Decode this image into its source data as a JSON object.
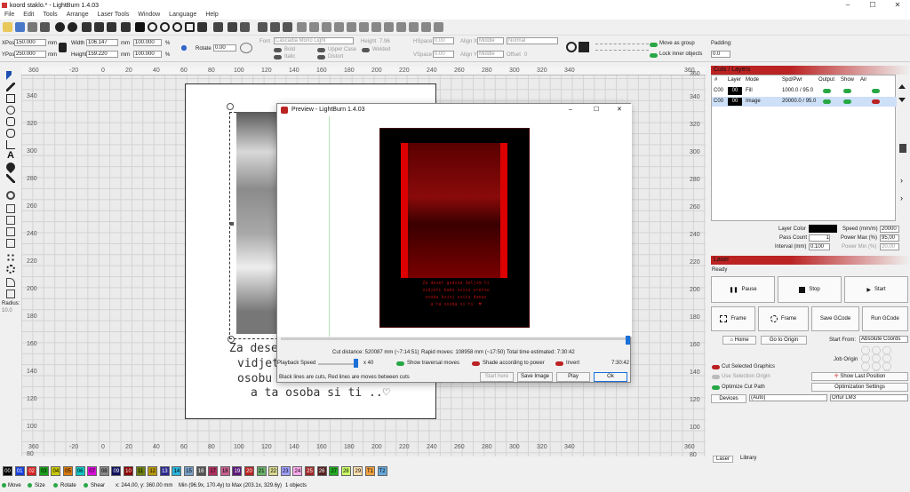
{
  "window": {
    "title": "koord staklo.* - LightBurn 1.4.03"
  },
  "menu": [
    "File",
    "Edit",
    "Tools",
    "Arrange",
    "Laser Tools",
    "Window",
    "Language",
    "Help"
  ],
  "position": {
    "xpos_label": "XPos",
    "xpos": "150.000",
    "ypos_label": "YPos",
    "ypos": "250.000",
    "unit": "mm",
    "width_label": "Width",
    "width": "106.147",
    "height_label": "Height",
    "height": "159.220",
    "wpct": "100.000",
    "hpct": "100.000",
    "pct": "%",
    "rotate_label": "Rotate",
    "rotate": "0.00"
  },
  "font": {
    "font_label": "Font",
    "font": "Cascadia Mono Light",
    "height_label": "Height",
    "height": "7.96",
    "hspace_label": "HSpace",
    "hspace": "0.00",
    "vspace_label": "VSpace",
    "vspace": "0.00",
    "bold": "Bold",
    "italic": "Italic",
    "upper": "Upper Case",
    "distort": "Distort",
    "welded": "Welded",
    "alignx_label": "Align X",
    "alignx": "Middle",
    "aligny_label": "Align Y",
    "aligny": "Middle",
    "normal": "Normal",
    "offset_label": "Offset",
    "offset": "0"
  },
  "group": {
    "move_as_group": "Move as group",
    "lock_inner": "Lock inner objects",
    "padding_label": "Padding:",
    "padding": "0.0"
  },
  "radius": {
    "label": "Radius:",
    "value": "10.0"
  },
  "ruler_top": [
    "-20",
    "0",
    "20",
    "40",
    "60",
    "80",
    "100",
    "120",
    "140",
    "160",
    "180",
    "200",
    "220",
    "240",
    "260",
    "280",
    "300",
    "320",
    "340",
    "360"
  ],
  "ruler_top_first": "360",
  "ruler_left": [
    "340",
    "320",
    "300",
    "280",
    "260",
    "240",
    "220",
    "200",
    "180",
    "160",
    "140",
    "120",
    "100",
    "80"
  ],
  "ruler_right": [
    "360",
    "340",
    "320",
    "300",
    "280",
    "260",
    "240",
    "220",
    "200",
    "180",
    "160",
    "140",
    "120",
    "100",
    "80"
  ],
  "ruler_bottom": [
    "360",
    "-20",
    "0",
    "20",
    "40",
    "60",
    "80",
    "100",
    "120",
    "140",
    "160",
    "180",
    "200",
    "220",
    "240",
    "260",
    "280",
    "300",
    "320",
    "340",
    "360"
  ],
  "poem": {
    "line1": "Za dese",
    "line2": "vidjet",
    "line3": "osobu",
    "line4": "a ta osoba si ti ..♡"
  },
  "preview": {
    "title": "Preview - LightBurn 1.4.03",
    "img_text": "Za deset godina željim ti\nvidjeti kako sviću sretnu\nosobu kojoj sviću danas\na ta osoba si ti  ♥",
    "cut_distance": "Cut distance: 520087 mm (~7:14:51)",
    "rapid": "Rapid moves: 108958 mm (~17:50)",
    "total": "Total time estimated: 7:30:42",
    "playback_label": "Playback Speed",
    "playback": "x 40",
    "show_traversal": "Show traversal moves",
    "shade": "Shade according to power",
    "invert": "Invert",
    "time": "7:30:42",
    "legend": "Black lines are cuts, Red lines are moves between cuts",
    "start_here": "Start here",
    "save_image": "Save Image",
    "play": "Play",
    "ok": "Ok"
  },
  "cuts": {
    "title": "Cuts / Layers",
    "cols": [
      "#",
      "Layer",
      "Mode",
      "Spd/Pwr",
      "Output",
      "Show",
      "Air"
    ],
    "rows": [
      {
        "num": "C00",
        "layer": "00",
        "mode": "Fill",
        "spd": "1000.0 / 95.0"
      },
      {
        "num": "C00",
        "layer": "00",
        "mode": "Image",
        "spd": "20000.0 / 95.0"
      }
    ],
    "layer_color_label": "Layer Color",
    "speed_label": "Speed (mm/m)",
    "speed": "20000",
    "pass_label": "Pass Count",
    "pass": "1",
    "pmax_label": "Power Max (%)",
    "pmax": "95,00",
    "interval_label": "Interval (mm)",
    "interval": "0.100",
    "pmin_label": "Power Min (%)",
    "pmin": "20,00"
  },
  "laser": {
    "title": "Laser",
    "status": "Ready",
    "pause": "Pause",
    "stop": "Stop",
    "start": "Start",
    "frame1": "Frame",
    "frame2": "Frame",
    "save_gcode": "Save GCode",
    "run_gcode": "Run GCode",
    "home": "Home",
    "goto_origin": "Go to Origin",
    "start_from_label": "Start From:",
    "start_from": "Absolute Coords",
    "job_origin": "Job Origin",
    "cut_selected": "Cut Selected Graphics",
    "use_selection": "Use Selection Origin",
    "show_last": "Show Last Position",
    "optimize": "Optimize Cut Path",
    "opt_settings": "Optimization Settings",
    "devices": "Devices",
    "auto": "(Auto)",
    "device": "Ortur LM3"
  },
  "tabs": {
    "laser": "Laser",
    "library": "Library"
  },
  "palette": [
    "00",
    "01",
    "02",
    "03",
    "04",
    "05",
    "06",
    "07",
    "08",
    "09",
    "10",
    "11",
    "12",
    "13",
    "14",
    "15",
    "16",
    "17",
    "18",
    "19",
    "20",
    "21",
    "22",
    "23",
    "24",
    "25",
    "26",
    "27",
    "28",
    "29",
    "T1",
    "T2"
  ],
  "palette_colors": [
    "#000",
    "#1740d8",
    "#d82020",
    "#1a9e1a",
    "#c8c800",
    "#d87a10",
    "#10c8c8",
    "#d810d8",
    "#888",
    "#11115c",
    "#8b0000",
    "#6b7f10",
    "#b8980c",
    "#2a2a8f",
    "#2ab3d8",
    "#78a0c8",
    "#555",
    "#b03060",
    "#c86090",
    "#5a1a7a",
    "#b82222",
    "#6ab06a",
    "#d8d890",
    "#a0a0ff",
    "#ffaaee",
    "#a02a2a",
    "#552222",
    "#22aa22",
    "#ccff66",
    "#ffe0b0",
    "#f0a040",
    "#66aadd"
  ],
  "status": {
    "move": "Move",
    "size": "Size",
    "rotate": "Rotate",
    "shear": "Shear",
    "coords": "x: 244.00, y: 360.00 mm",
    "minmax": "Min (96.9x, 170.4y) to Max (203.1x, 329.6y)",
    "objects": "1 objects"
  }
}
